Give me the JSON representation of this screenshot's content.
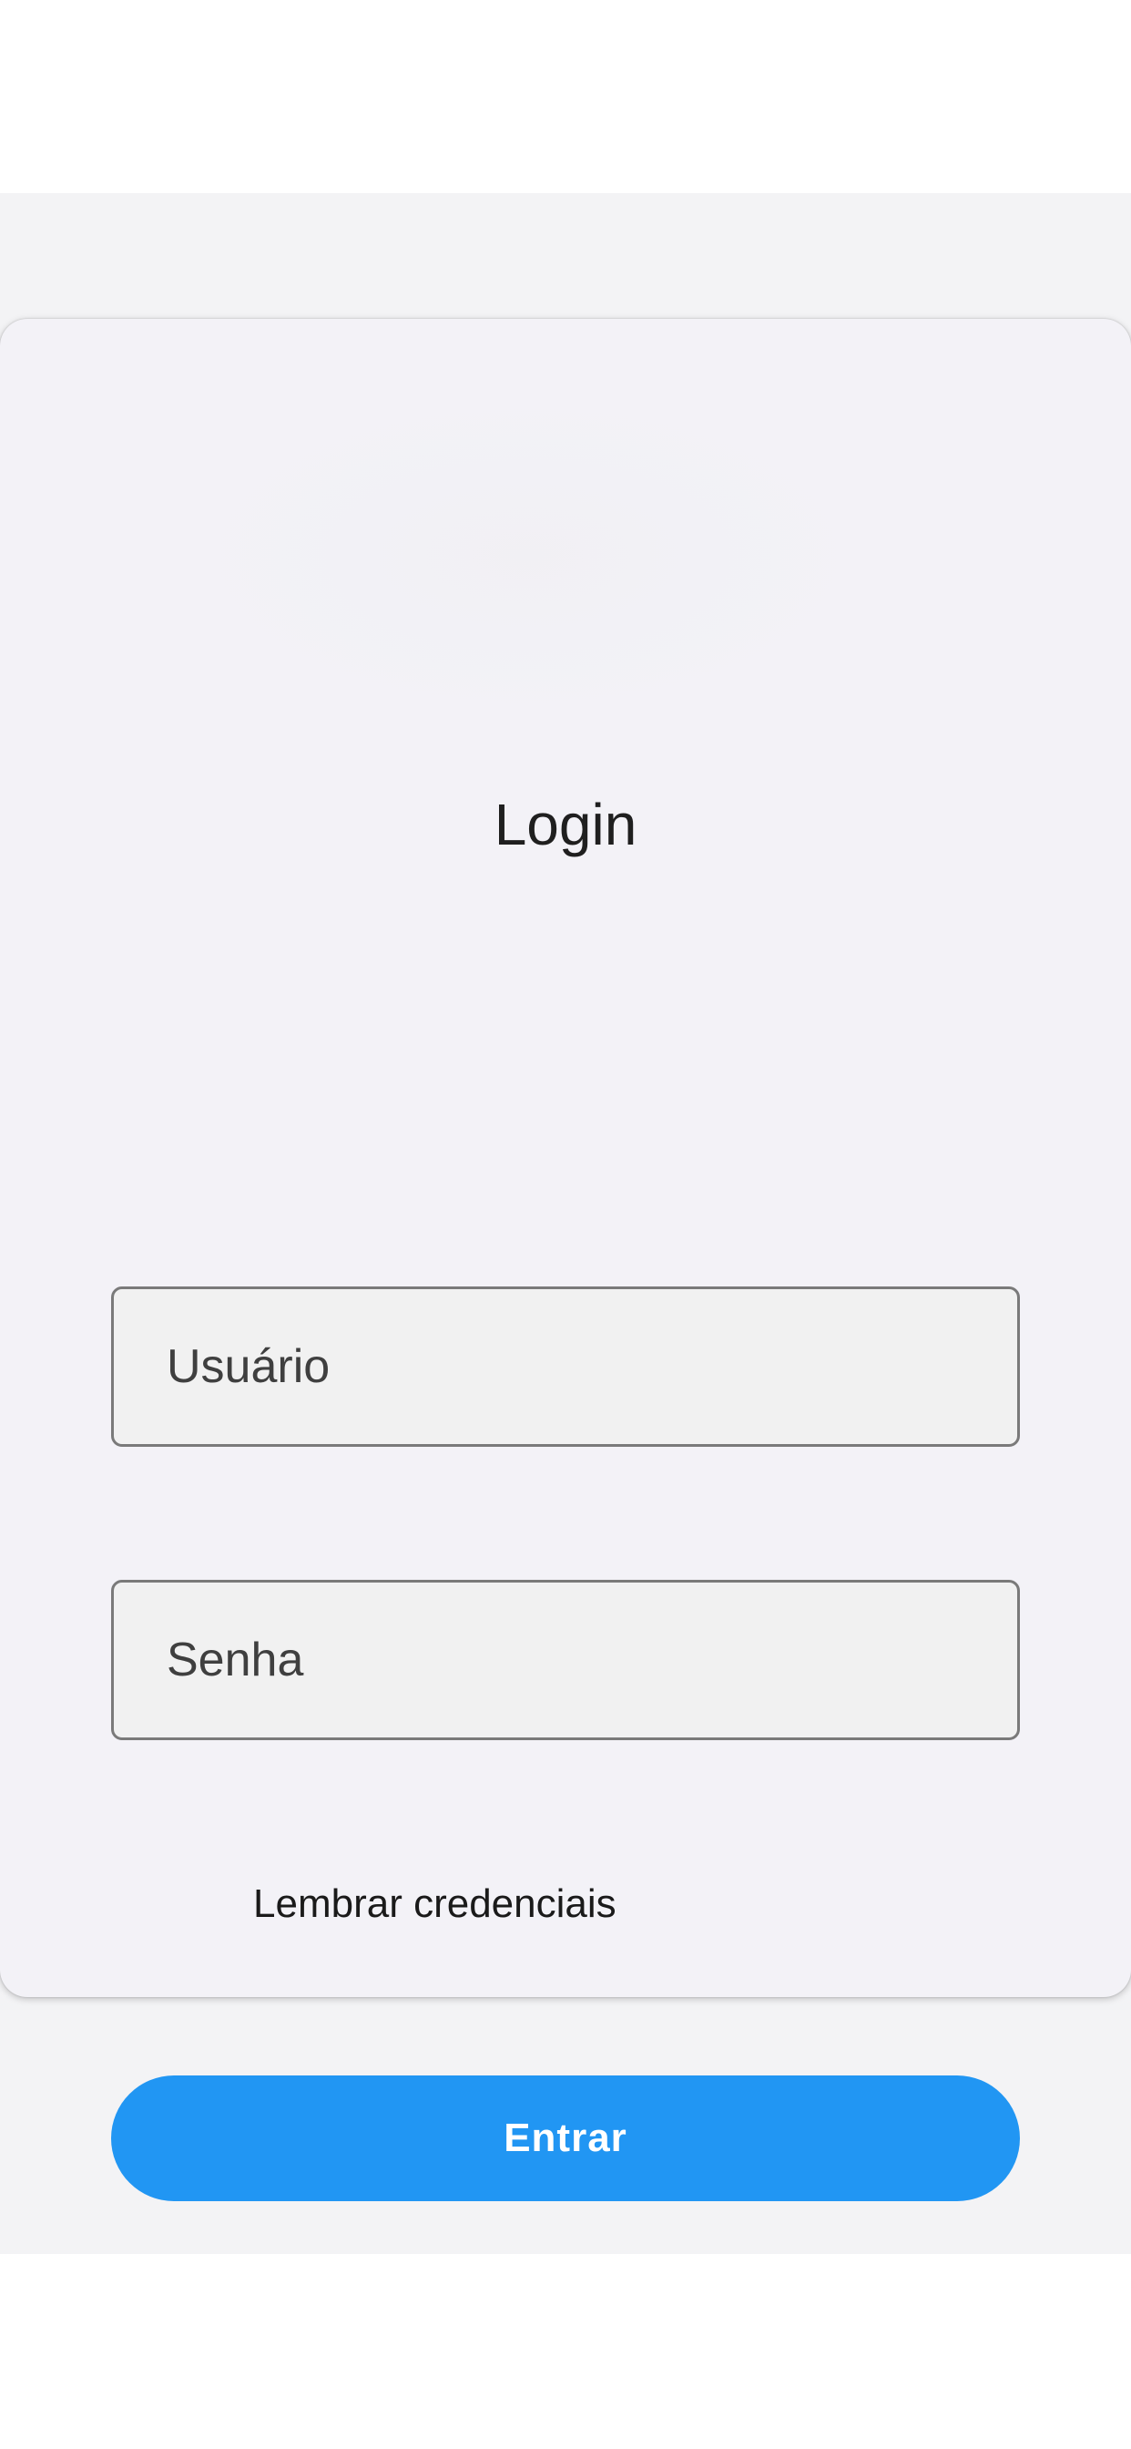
{
  "login": {
    "title": "Login",
    "username_placeholder": "Usuário",
    "password_placeholder": "Senha",
    "remember_label": "Lembrar credenciais",
    "submit_label": "Entrar"
  },
  "colors": {
    "accent": "#2196f3",
    "card_background": "#f3f2f7",
    "field_background": "#f1f1f1"
  }
}
